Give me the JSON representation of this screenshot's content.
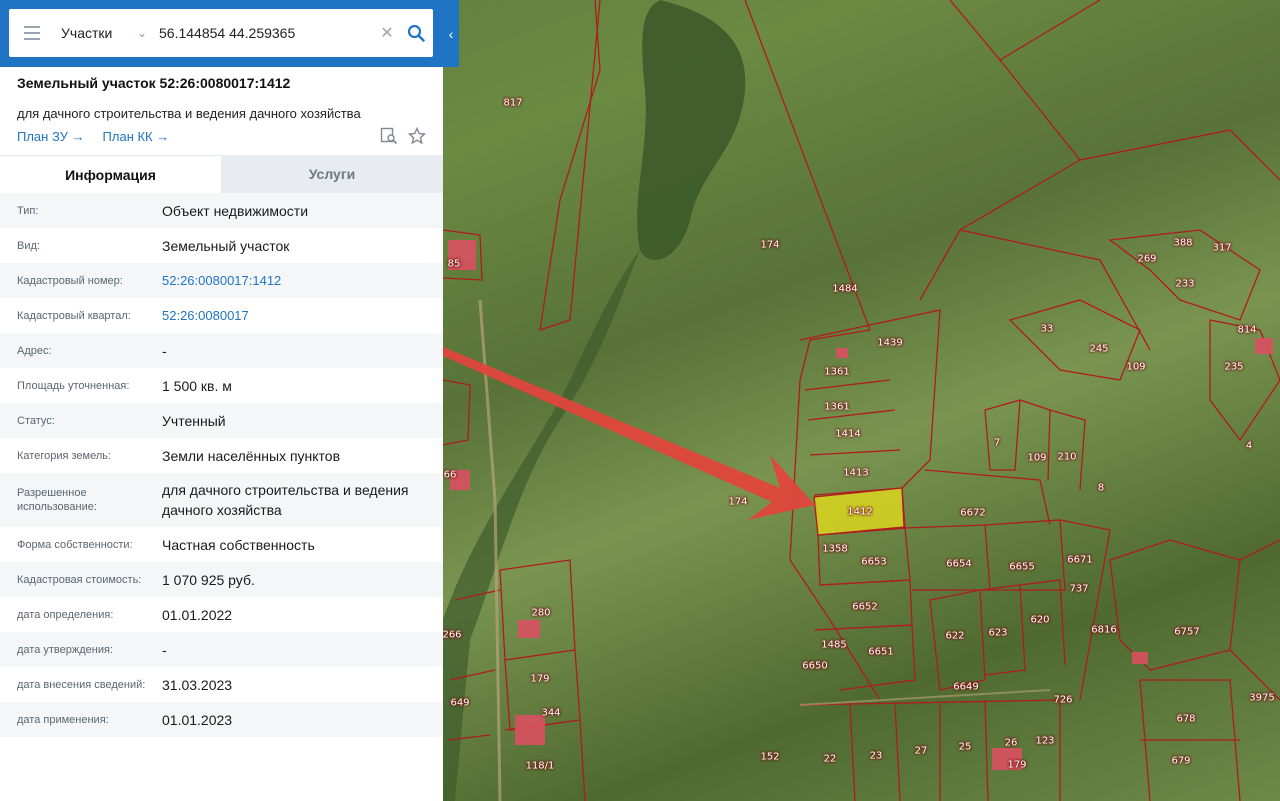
{
  "search": {
    "layer": "Участки",
    "query": "56.144854 44.259365"
  },
  "panel": {
    "title": "Земельный участок 52:26:0080017:1412",
    "subtitle": "для дачного строительства и ведения дачного хозяйства",
    "link_plan_zu": "План ЗУ →",
    "link_plan_kk": "План КК →",
    "tabs": [
      {
        "label": "Информация",
        "active": true
      },
      {
        "label": "Услуги",
        "active": false
      }
    ],
    "rows": [
      {
        "label": "Тип:",
        "value": "Объект недвижимости"
      },
      {
        "label": "Вид:",
        "value": "Земельный участок"
      },
      {
        "label": "Кадастровый номер:",
        "value": "52:26:0080017:1412",
        "link": true
      },
      {
        "label": "Кадастровый квартал:",
        "value": "52:26:0080017",
        "link": true
      },
      {
        "label": "Адрес:",
        "value": "-"
      },
      {
        "label": "Площадь уточненная:",
        "value": "1 500 кв. м"
      },
      {
        "label": "Статус:",
        "value": "Учтенный"
      },
      {
        "label": "Категория земель:",
        "value": "Земли населённых пунктов"
      },
      {
        "label": "Разрешенное использование:",
        "value": "для дачного строительства и ведения дачного хозяйства"
      },
      {
        "label": "Форма собственности:",
        "value": "Частная собственность"
      },
      {
        "label": "Кадастровая стоимость:",
        "value": "1 070 925 руб."
      },
      {
        "label": "дата определения:",
        "value": "01.01.2022"
      },
      {
        "label": "дата утверждения:",
        "value": "-"
      },
      {
        "label": "дата внесения сведений:",
        "value": "31.03.2023"
      },
      {
        "label": "дата применения:",
        "value": "01.01.2023"
      }
    ]
  },
  "map": {
    "parcel_labels": [
      "817",
      "174",
      "1484",
      "1439",
      "1361",
      "1361",
      "1414",
      "1413",
      "1412",
      "174",
      "1358",
      "6653",
      "6652",
      "1485",
      "6651",
      "6650",
      "152",
      "22",
      "23",
      "27",
      "25",
      "26",
      "179",
      "123",
      "6649",
      "6654",
      "6655",
      "6672",
      "6671",
      "737",
      "622",
      "623",
      "620",
      "6816",
      "6757",
      "678",
      "679",
      "3975",
      "726",
      "33",
      "245",
      "109",
      "7",
      "109",
      "210",
      "8",
      "269",
      "388",
      "317",
      "233",
      "814",
      "235",
      "4",
      "85",
      "66",
      "344",
      "179",
      "280",
      "118/1",
      "266",
      "649"
    ],
    "highlight_color": "#e8e01a",
    "border_color": "#b01c1c",
    "arrow_color": "#e0463c"
  }
}
